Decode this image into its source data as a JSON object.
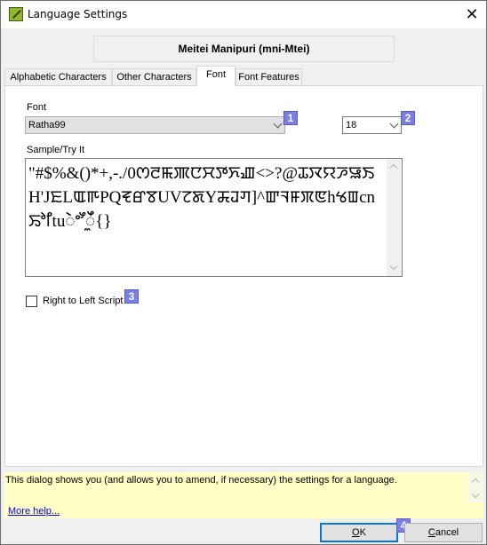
{
  "window": {
    "title": "Language Settings",
    "app_icon": "app-leaf-icon",
    "close_icon": "close-icon",
    "close_glyph": "✕"
  },
  "header": {
    "language_name": "Meitei Manipuri (mni-Mtei)"
  },
  "tabs": [
    {
      "label": "Alphabetic Characters",
      "active": false
    },
    {
      "label": "Other Characters",
      "active": false
    },
    {
      "label": "Font",
      "active": true
    },
    {
      "label": "Font Features",
      "active": false
    }
  ],
  "font_tab": {
    "font_label": "Font",
    "font_value": "Ratha99",
    "size_value": "18",
    "sample_label": "Sample/Try It",
    "sample_text": "\"#$%&()*+,-./0ꯁꯂꯃꯄꯅꯆꯇꯈꯉ<>?@ꯊꯋꯌꯍꯎꯏH'JꯐLꯑꯒPQꯓꯔꯕUVꯖꯗYꯘꯙꯚ]^ꯛꯜꯝꯞꯟhꯠꯡcnꯢꯣꯤtuꯥꯦꯧꯨꯩ{}",
    "rtl_label": "Right to Left Script",
    "rtl_checked": false
  },
  "badges": [
    "1",
    "2",
    "3",
    "4"
  ],
  "help": {
    "text": "This dialog shows you (and allows you to amend, if necessary) the settings for a language.",
    "link": "More help..."
  },
  "buttons": {
    "ok_mnemonic": "O",
    "ok_rest": "K",
    "cancel_mnemonic": "C",
    "cancel_rest": "ancel"
  },
  "colors": {
    "badge": "#7b7ee6",
    "help_bg": "#ffffc6",
    "default_button_border": "#0078d7",
    "link": "#0000ee"
  }
}
